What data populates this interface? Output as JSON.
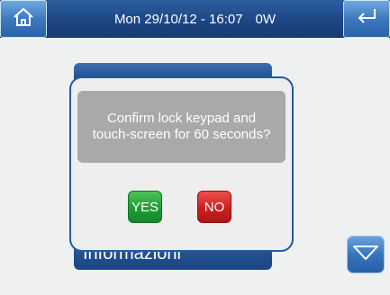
{
  "topbar": {
    "datetime": "Mon 29/10/12 - 16:07",
    "power": "0W",
    "home_icon": "home-icon",
    "back_icon": "return-arrow-icon"
  },
  "menu": {
    "bottom_item_label": "Informazioni"
  },
  "dialog": {
    "message_line1": "Confirm lock keypad and",
    "message_line2": "touch-screen for 60 seconds?",
    "yes_label": "YES",
    "no_label": "NO"
  },
  "scroll": {
    "down_icon": "chevron-down-icon"
  },
  "colors": {
    "accent_blue": "#1d4684",
    "yes_green": "#1f9b35",
    "no_red": "#cc1f1f",
    "message_gray": "#a9a9a9"
  }
}
